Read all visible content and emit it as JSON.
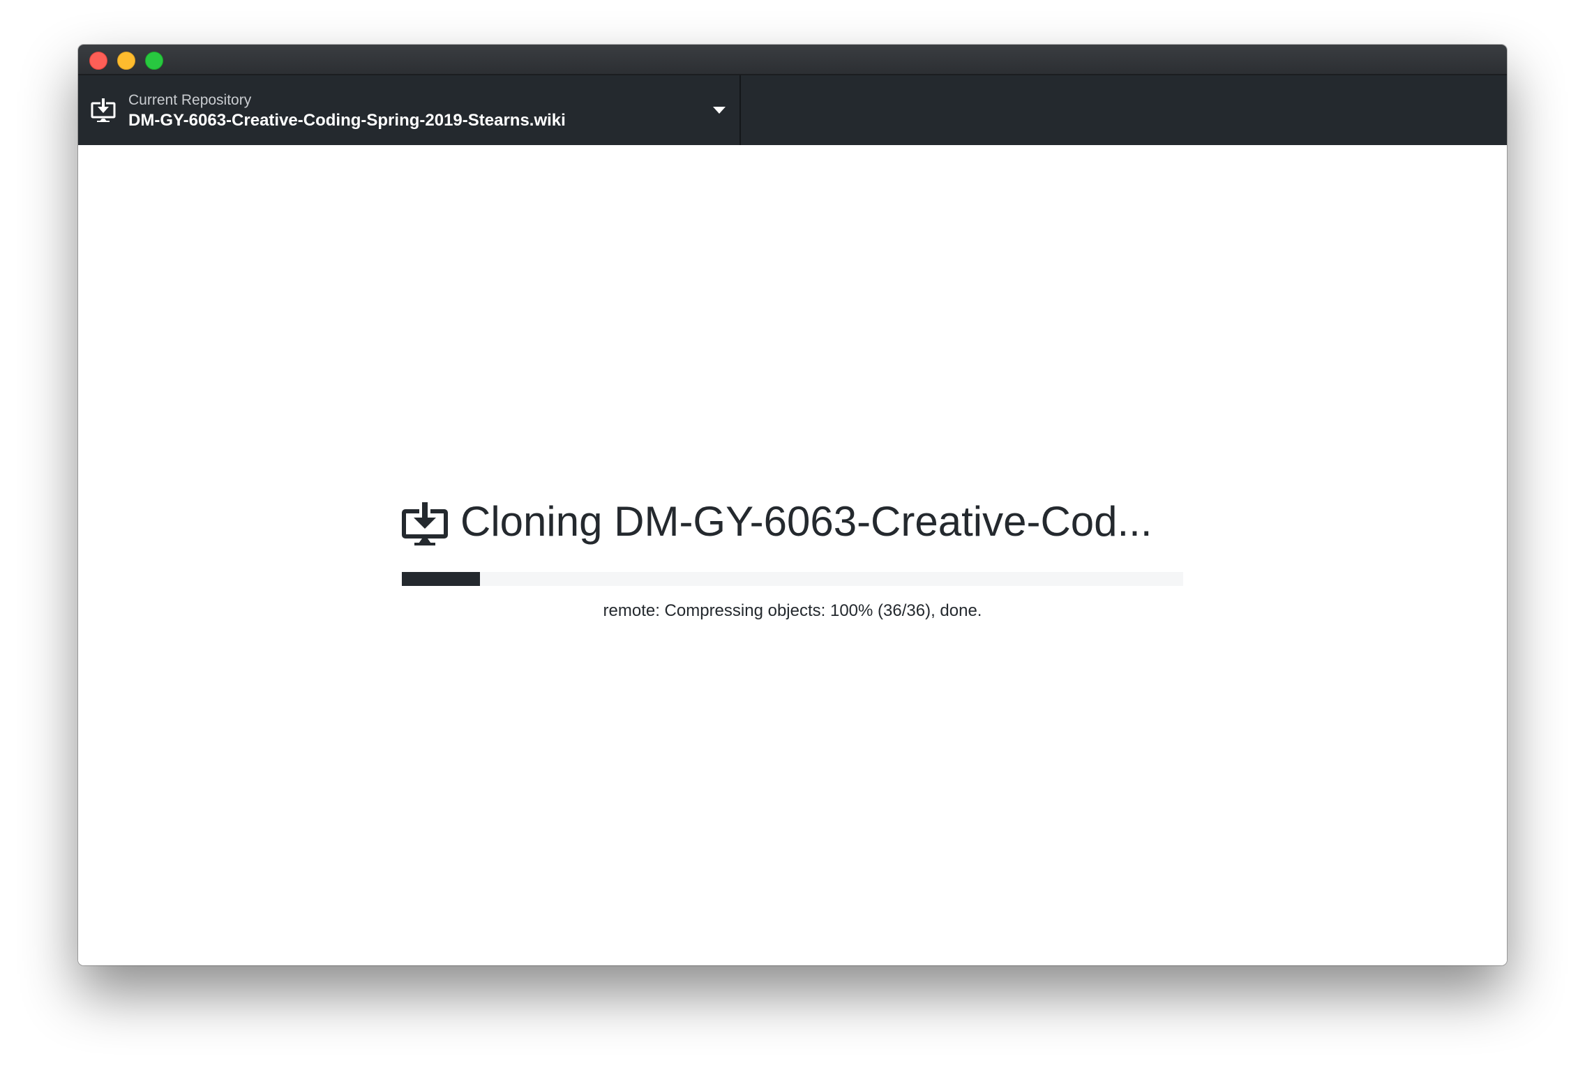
{
  "window": {
    "controls": [
      "close",
      "minimize",
      "maximize"
    ]
  },
  "toolbar": {
    "repository": {
      "label": "Current Repository",
      "name": "DM-GY-6063-Creative-Coding-Spring-2019-Stearns.wiki",
      "icon": "clone-repo-icon"
    }
  },
  "clone": {
    "title": "Cloning DM-GY-6063-Creative-Cod...",
    "icon": "clone-repo-icon",
    "progress": 0.1,
    "status": "remote: Compressing objects: 100% (36/36), done."
  },
  "colors": {
    "toolbar_bg": "#24292e",
    "progress_fill": "#24292e",
    "progress_track": "#f5f6f7"
  }
}
